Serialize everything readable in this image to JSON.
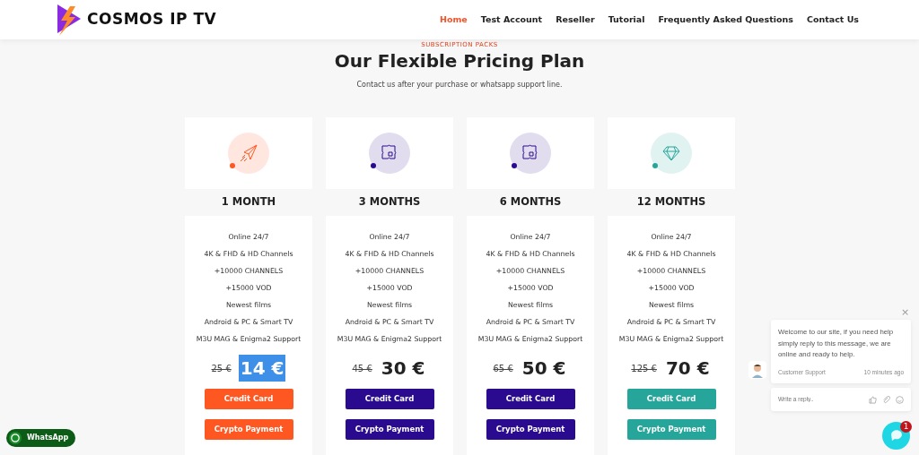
{
  "header": {
    "logo_text": "COSMOS IP TV",
    "nav": [
      {
        "label": "Home",
        "selected": true
      },
      {
        "label": "Test Account",
        "selected": false
      },
      {
        "label": "Reseller",
        "selected": false
      },
      {
        "label": "Tutorial",
        "selected": false
      },
      {
        "label": "Frequently Asked Questions",
        "selected": false
      },
      {
        "label": "Contact Us",
        "selected": false
      }
    ]
  },
  "section": {
    "eyebrow": "SUBSCRIPTION PACKS",
    "title": "Our Flexible Pricing Plan",
    "subtitle": "Contact us after your purchase or whatsapp support line."
  },
  "plans": [
    {
      "kind": "plane",
      "color": "#ff5722",
      "name": "1 MONTH",
      "features": [
        "Online 24/7",
        "4K & FHD & HD Channels",
        "+10000 CHANNELS",
        "+15000 VOD",
        "Newest films",
        "Android & PC & Smart TV",
        "M3U MAG & Enigma2 Support"
      ],
      "old_price": "25 €",
      "price": "14 €",
      "price_highlighted": true,
      "buttons": [
        "Credit Card",
        "Crypto Payment"
      ]
    },
    {
      "kind": "puzzle",
      "color": "#2a0a8f",
      "name": "3 MONTHS",
      "features": [
        "Online 24/7",
        "4K & FHD & HD Channels",
        "+10000 CHANNELS",
        "+15000 VOD",
        "Newest films",
        "Android & PC & Smart TV",
        "M3U MAG & Enigma2 Support"
      ],
      "old_price": "45 €",
      "price": "30 €",
      "price_highlighted": false,
      "buttons": [
        "Credit Card",
        "Crypto Payment"
      ]
    },
    {
      "kind": "puzzle",
      "color": "#2a0a8f",
      "name": "6 MONTHS",
      "features": [
        "Online 24/7",
        "4K & FHD & HD Channels",
        "+10000 CHANNELS",
        "+15000 VOD",
        "Newest films",
        "Android & PC & Smart TV",
        "M3U MAG & Enigma2 Support"
      ],
      "old_price": "65 €",
      "price": "50 €",
      "price_highlighted": false,
      "buttons": [
        "Credit Card",
        "Crypto Payment"
      ]
    },
    {
      "kind": "diamond",
      "color": "#26a69a",
      "name": "12 MONTHS",
      "features": [
        "Online 24/7",
        "4K & FHD & HD Channels",
        "+10000 CHANNELS",
        "+15000 VOD",
        "Newest films",
        "Android & PC & Smart TV",
        "M3U MAG & Enigma2 Support"
      ],
      "old_price": "125 €",
      "price": "70 €",
      "price_highlighted": false,
      "buttons": [
        "Credit Card",
        "Crypto Payment"
      ]
    }
  ],
  "whatsapp": {
    "label": "WhatsApp"
  },
  "chat": {
    "close": "×",
    "message": "Welcome to our site, if you need help simply reply to this message, we are online and ready to help.",
    "sender": "Customer Support",
    "time": "10 minutes ago",
    "placeholder": "Write a reply..",
    "unread": "1"
  }
}
